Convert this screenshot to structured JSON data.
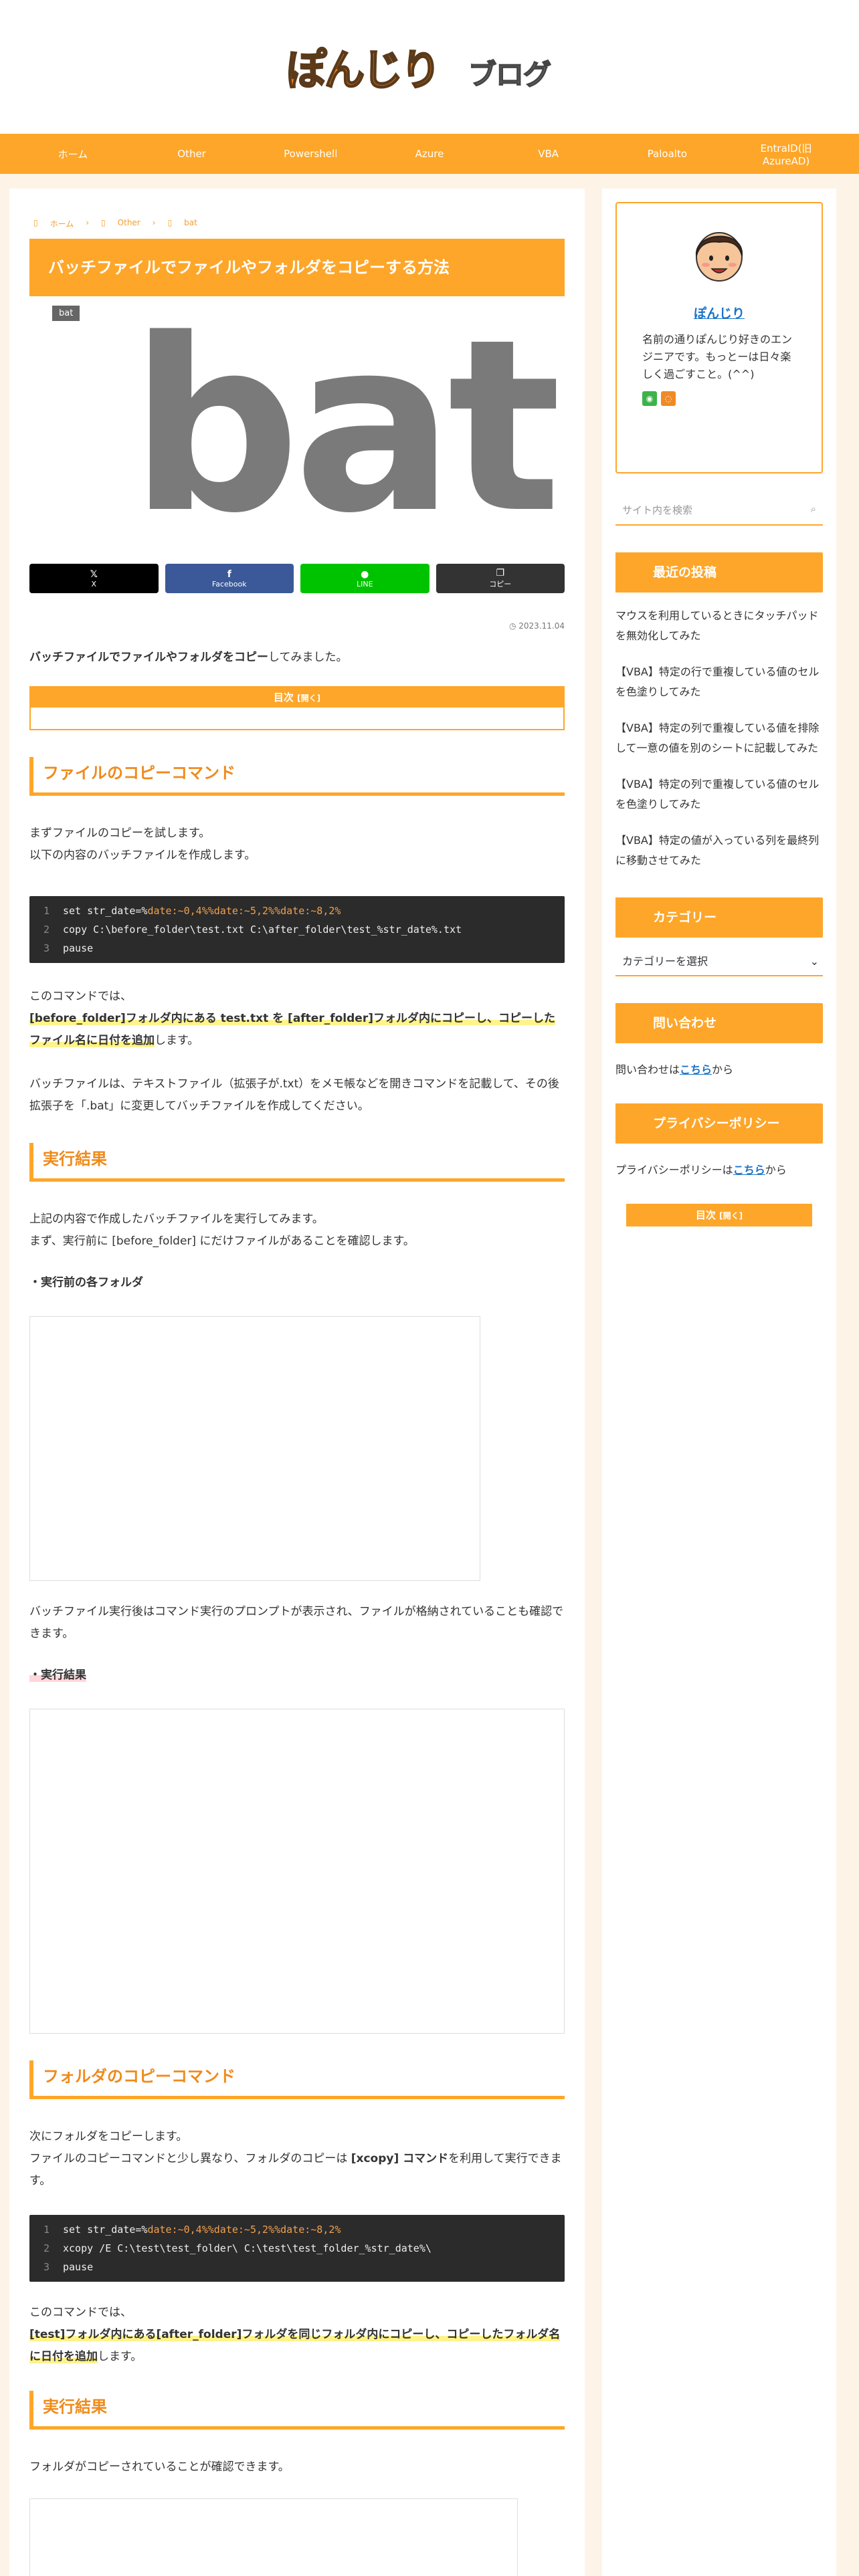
{
  "logo": {
    "word": "ぽんじり",
    "blog": "ブログ"
  },
  "nav": [
    "ホーム",
    "Other",
    "Powershell",
    "Azure",
    "VBA",
    "Paloalto",
    "EntraID(旧AzureAD)"
  ],
  "breadcrumb": [
    "ホーム",
    "Other",
    "bat"
  ],
  "article": {
    "title": "バッチファイルでファイルやフォルダをコピーする方法",
    "category": "bat",
    "eyecatch_text": "bat",
    "share": [
      {
        "icon": "𝕏",
        "label": "X",
        "color": "#000000"
      },
      {
        "icon": "f",
        "label": "Facebook",
        "color": "#3b5998"
      },
      {
        "icon": "●",
        "label": "LINE",
        "color": "#00c300"
      },
      {
        "icon": "❐",
        "label": "コピー",
        "color": "#333333"
      }
    ],
    "date": "2023.11.04",
    "lead_bold": "バッチファイルでファイルやフォルダをコピー",
    "lead_rest": "してみました。",
    "toc_label": "目次",
    "toc_open": "[開く]",
    "h2_1": "ファイルのコピーコマンド",
    "p1_a": "まずファイルのコピーを試します。",
    "p1_b": "以下の内容のバッチファイルを作成します。",
    "code1": {
      "l1_a": "set str_date=%",
      "l1_b": "date",
      "l1_c": ":~0,4%%",
      "l1_d": "date",
      "l1_e": ":~5,2%%",
      "l1_f": "date",
      "l1_g": ":~8,2%",
      "l2": "copy C:\\before_folder\\test.txt C:\\after_folder\\test_%str_date%.txt",
      "l3": "pause"
    },
    "p2_a": "このコマンドでは、",
    "p2_hl": "[before_folder]フォルダ内にある test.txt を [after_folder]フォルダ内にコピーし、コピーしたファイル名に日付を追加",
    "p2_end": "します。",
    "p3": "バッチファイルは、テキストファイル（拡張子が.txt）をメモ帳などを開きコマンドを記載して、その後拡張子を「.bat」に変更してバッチファイルを作成してください。",
    "h2_2": "実行結果",
    "p4_a": "上記の内容で作成したバッチファイルを実行してみます。",
    "p4_b": "まず、実行前に [before_folder] にだけファイルがあることを確認します。",
    "sub1": "・実行前の各フォルダ",
    "p5": "バッチファイル実行後はコマンド実行のプロンプトが表示され、ファイルが格納されていることも確認できます。",
    "sub2": "・実行結果",
    "h2_3": "フォルダのコピーコマンド",
    "p6_a": "次にフォルダをコピーします。",
    "p6_b1": "ファイルのコピーコマンドと少し異なり、フォルダのコピーは ",
    "p6_bold": "[xcopy] コマンド",
    "p6_b2": "を利用して実行できます。",
    "code2": {
      "l2": "xcopy /E C:\\test\\test_folder\\ C:\\test\\test_folder_%str_date%\\",
      "l3": "pause"
    },
    "p7_a": "このコマンドでは、",
    "p7_hl": "[test]フォルダ内にある[after_folder]フォルダを同じフォルダ内にコピーし、コピーしたフォルダ名に日付を追加",
    "p7_end": "します。",
    "h2_4": "実行結果",
    "p8": "フォルダがコピーされていることが確認できます。"
  },
  "sidebar": {
    "profile_name": "ぽんじり",
    "profile_desc": "名前の通りぽんじり好きのエンジニアです。もっとーは日々楽しく過ごすこと。(^^)",
    "search_placeholder": "サイト内を検索",
    "recent_title": "最近の投稿",
    "recent": [
      "マウスを利用しているときにタッチパッドを無効化してみた",
      "【VBA】特定の行で重複している値のセルを色塗りしてみた",
      "【VBA】特定の列で重複している値を排除して一意の値を別のシートに記載してみた",
      "【VBA】特定の列で重複している値のセルを色塗りしてみた",
      "【VBA】特定の値が入っている列を最終列に移動させてみた"
    ],
    "category_title": "カテゴリー",
    "category_select": "カテゴリーを選択",
    "contact_title": "問い合わせ",
    "contact_a": "問い合わせは",
    "contact_link": "こちら",
    "contact_b": "から",
    "privacy_title": "プライバシーポリシー",
    "privacy_a": "プライバシーポリシーは",
    "privacy_link": "こちら",
    "privacy_b": "から",
    "toc_label": "目次",
    "toc_open": "[開く]"
  }
}
